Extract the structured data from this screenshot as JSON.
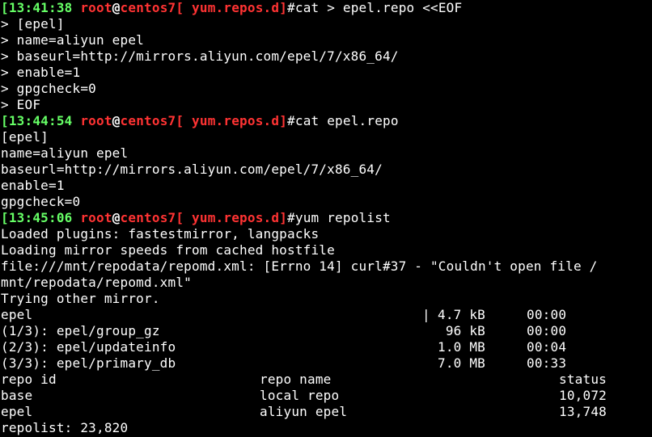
{
  "colors": {
    "background": "#000000",
    "text": "#ffffff",
    "prompt_time": "#66ff66",
    "prompt_user_host_path": "#ff3333"
  },
  "prompts": [
    {
      "time": "[13:41:38",
      "user": "root",
      "at": "@",
      "host": "centos7[",
      "path": " yum.repos.d]",
      "cmd": "#cat > epel.repo <<EOF"
    },
    {
      "time": "[13:44:54",
      "user": "root",
      "at": "@",
      "host": "centos7[",
      "path": " yum.repos.d]",
      "cmd": "#cat epel.repo"
    },
    {
      "time": "[13:45:06",
      "user": "root",
      "at": "@",
      "host": "centos7[",
      "path": " yum.repos.d]",
      "cmd": "#yum repolist"
    }
  ],
  "heredoc_lines": [
    "> [epel]",
    "> name=aliyun epel",
    "> baseurl=http://mirrors.aliyun.com/epel/7/x86_64/",
    "> enable=1",
    "> gpgcheck=0",
    "> EOF"
  ],
  "cat_output": [
    "[epel]",
    "name=aliyun epel",
    "baseurl=http://mirrors.aliyun.com/epel/7/x86_64/",
    "enable=1",
    "gpgcheck=0"
  ],
  "yum_output": [
    "Loaded plugins: fastestmirror, langpacks",
    "Loading mirror speeds from cached hostfile",
    "file:///mnt/repodata/repomd.xml: [Errno 14] curl#37 - \"Couldn't open file /",
    "mnt/repodata/repomd.xml\"",
    "Trying other mirror."
  ],
  "downloads": [
    {
      "name": "epel",
      "bar": "|",
      "size": "4.7 kB",
      "time": "00:00"
    },
    {
      "name": "(1/3): epel/group_gz",
      "bar": "|",
      "size": " 96 kB",
      "time": "00:00"
    },
    {
      "name": "(2/3): epel/updateinfo",
      "bar": "|",
      "size": "1.0 MB",
      "time": "00:04"
    },
    {
      "name": "(3/3): epel/primary_db",
      "bar": "|",
      "size": "7.0 MB",
      "time": "00:33"
    }
  ],
  "repo_table": {
    "headers": {
      "id": "repo id",
      "name": "repo name",
      "status": "status"
    },
    "rows": [
      {
        "id": "base",
        "name": "local repo",
        "status": "10,072"
      },
      {
        "id": "epel",
        "name": "aliyun epel",
        "status": "13,748"
      }
    ]
  },
  "repolist_summary": "repolist: 23,820"
}
